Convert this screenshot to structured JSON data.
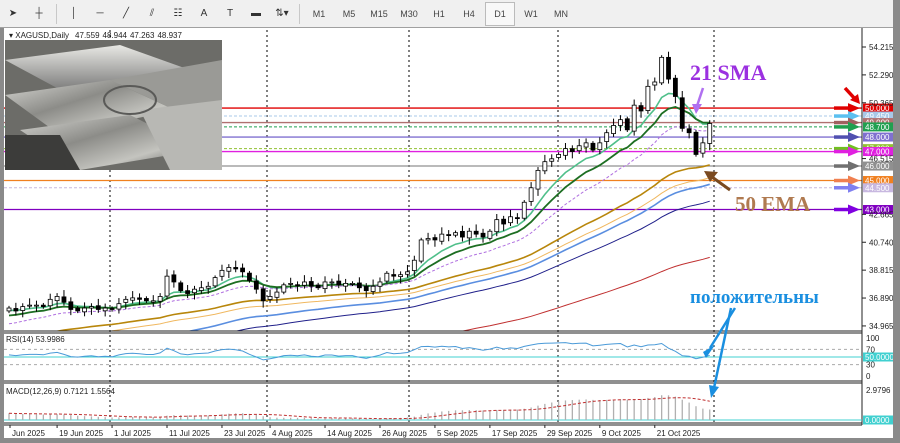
{
  "toolbar": {
    "tools": [
      {
        "name": "cursor-icon",
        "glyph": "➤"
      },
      {
        "name": "crosshair-icon",
        "glyph": "┼"
      },
      {
        "name": "vertical-line-icon",
        "glyph": "│"
      },
      {
        "name": "horizontal-line-icon",
        "glyph": "─"
      },
      {
        "name": "trendline-icon",
        "glyph": "╱"
      },
      {
        "name": "equidistant-channel-icon",
        "glyph": "⫽"
      },
      {
        "name": "fibonacci-icon",
        "glyph": "☷"
      },
      {
        "name": "text-icon",
        "glyph": "A"
      },
      {
        "name": "text-label-icon",
        "glyph": "T"
      },
      {
        "name": "rectangle-icon",
        "glyph": "▬"
      },
      {
        "name": "arrows-dropdown-icon",
        "glyph": "⇅▾"
      }
    ],
    "timeframes": [
      "M1",
      "M5",
      "M15",
      "M30",
      "H1",
      "H4",
      "D1",
      "W1",
      "MN"
    ],
    "active_timeframe": "D1"
  },
  "chart_data": {
    "type": "candlestick",
    "symbol_header": "XAGUSD,Daily",
    "ohlc_last": [
      "47.559",
      "48.944",
      "47.263",
      "48.937"
    ],
    "closes": [
      36.2,
      36.0,
      36.3,
      36.4,
      36.4,
      36.3,
      36.8,
      37.0,
      36.6,
      36.1,
      36.0,
      36.2,
      36.3,
      36.1,
      36.2,
      36.1,
      36.5,
      36.8,
      36.9,
      36.8,
      36.7,
      36.7,
      37.0,
      38.4,
      38.0,
      37.4,
      37.2,
      37.5,
      37.6,
      37.7,
      38.3,
      38.8,
      39.0,
      38.9,
      38.7,
      38.1,
      37.5,
      36.7,
      37.0,
      37.3,
      37.8,
      37.9,
      37.8,
      38.0,
      37.7,
      37.6,
      38.0,
      38.0,
      37.8,
      37.9,
      37.9,
      37.6,
      37.4,
      37.7,
      38.0,
      38.6,
      38.4,
      38.5,
      38.7,
      39.5,
      40.9,
      41.0,
      40.9,
      41.3,
      41.2,
      41.4,
      41.1,
      41.5,
      41.3,
      41.1,
      41.5,
      42.3,
      42.0,
      42.5,
      42.4,
      43.5,
      44.5,
      45.7,
      46.3,
      46.5,
      46.8,
      47.2,
      47.0,
      47.4,
      47.6,
      47.1,
      47.6,
      48.3,
      48.8,
      49.2,
      48.5,
      50.2,
      49.8,
      51.5,
      51.8,
      53.5,
      52.0,
      50.8,
      48.6,
      48.3,
      46.8,
      47.6,
      48.937
    ],
    "price_axis": [
      "54.215",
      "52.290",
      "50.365",
      "46.515",
      "42.665",
      "40.740",
      "38.815",
      "36.890",
      "34.965"
    ],
    "ylim": [
      34.965,
      54.215
    ],
    "date_labels": [
      "Jun 2025",
      "19 Jun 2025",
      "1 Jul 2025",
      "11 Jul 2025",
      "23 Jul 2025",
      "4 Aug 2025",
      "14 Aug 2025",
      "26 Aug 2025",
      "5 Sep 2025",
      "17 Sep 2025",
      "29 Sep 2025",
      "9 Oct 2025",
      "21 Oct 2025"
    ],
    "levels": [
      {
        "price": 50.0,
        "label": "50.000",
        "color": "#e00000",
        "arrow": "#e00000"
      },
      {
        "price": 49.45,
        "label": "49.450",
        "color": "#a8c8e8",
        "arrow": "#5bc0f0",
        "dashed": true
      },
      {
        "price": 49.0,
        "label": "49.000",
        "color": "#b07070",
        "arrow": "#a06060"
      },
      {
        "price": 48.7,
        "label": "48.700",
        "color": "#20a050",
        "arrow": "#20a050",
        "dashed": true
      },
      {
        "price": 48.0,
        "label": "48.000",
        "color": "#8070d0",
        "arrow": "#5050b0"
      },
      {
        "price": 47.2,
        "label": "47.200",
        "color": "#90c030",
        "arrow": "#70c020",
        "dashed": true
      },
      {
        "price": 47.0,
        "label": "47.000",
        "color": "#e020e0",
        "arrow": "#e020e0"
      },
      {
        "price": 46.0,
        "label": "46.000",
        "color": "#909090",
        "arrow": "#707070"
      },
      {
        "price": 45.0,
        "label": "45.000",
        "color": "#f08020",
        "arrow": "#f08050"
      },
      {
        "price": 44.5,
        "label": "44.500",
        "color": "#c8b8e0",
        "arrow": "#8080f0",
        "dashed": true
      },
      {
        "price": 43.0,
        "label": "43.000",
        "color": "#8000c0",
        "arrow": "#8000e0"
      }
    ],
    "indicators": {
      "rsi": {
        "label": "RSI(14) 53.9986",
        "axis": [
          "100",
          "70",
          "30",
          "0"
        ],
        "current": "50.0000"
      },
      "macd": {
        "label": "MACD(12,26,9) 0.7121 1.5564",
        "axis_max": "2.9796",
        "axis_zero": "0.0000"
      }
    }
  },
  "annotations": {
    "sma21": "21 SMA",
    "ema50": "50 EMA",
    "positive": "положительны",
    "sma21_color": "#9b30e0",
    "ema50_color": "#b07a50",
    "positive_color": "#1a8fe0"
  }
}
